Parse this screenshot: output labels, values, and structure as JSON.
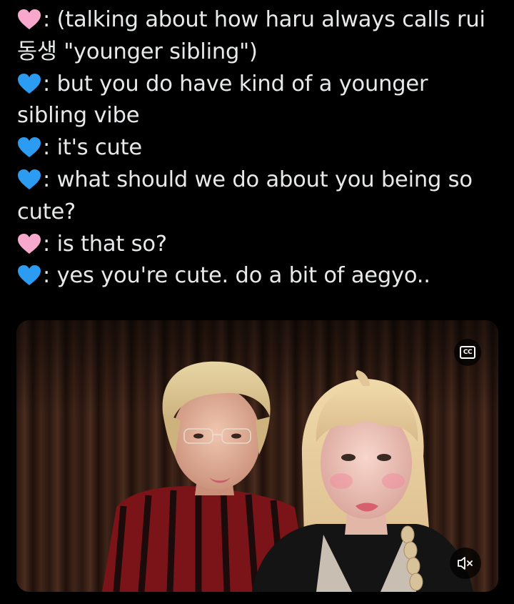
{
  "tweet": {
    "lines": [
      {
        "heart": "pink-heart",
        "text": ": (talking about how haru always calls rui"
      },
      {
        "heart": null,
        "text": "동생 \"younger sibling\")"
      },
      {
        "heart": "blue-heart",
        "text": ":  but you do have kind of a younger"
      },
      {
        "heart": null,
        "text": "sibling vibe"
      },
      {
        "heart": "blue-heart",
        "text": ": it's cute"
      },
      {
        "heart": "blue-heart",
        "text": ": what should we do about you being so"
      },
      {
        "heart": null,
        "text": "cute?"
      },
      {
        "heart": "pink-heart",
        "text": ": is that so?"
      },
      {
        "heart": "blue-heart",
        "text": ": yes you're cute. do a bit of aegyo.."
      }
    ]
  },
  "media": {
    "cc_label": "CC",
    "cc_icon": "closed-captions-icon",
    "mute_icon": "muted-speaker-icon"
  },
  "colors": {
    "background": "#000000",
    "text": "#e7e9ea",
    "pink_heart": "#f7a8cc",
    "blue_heart": "#2c9cf2"
  }
}
